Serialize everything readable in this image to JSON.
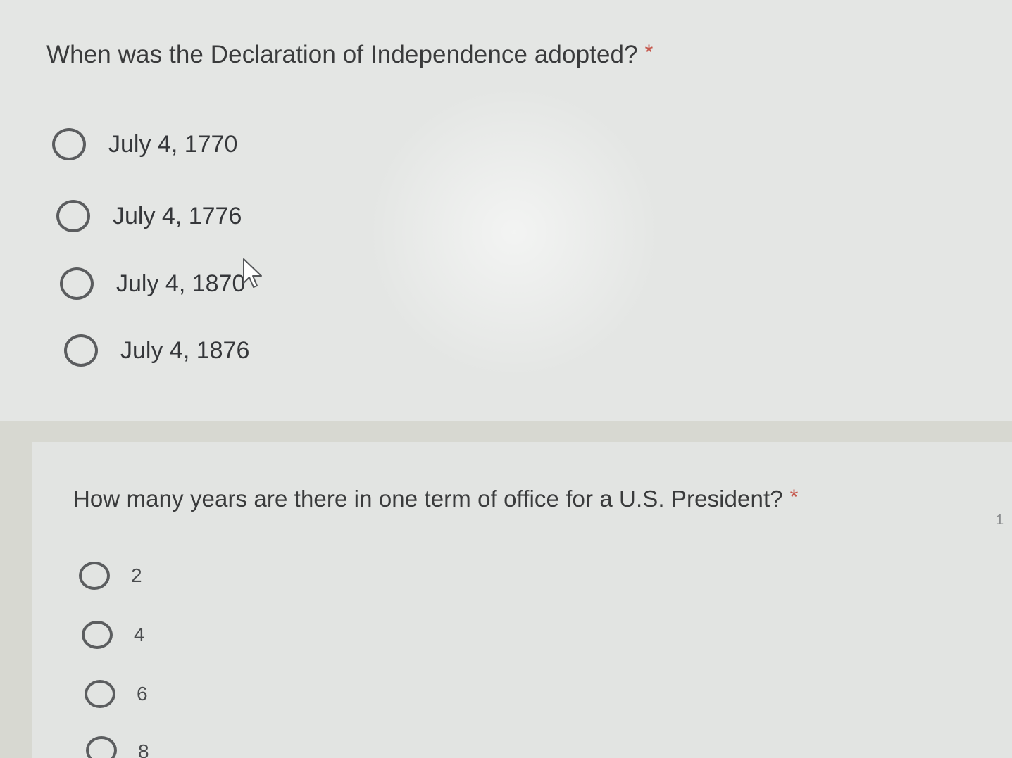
{
  "questions": [
    {
      "title": "When was the Declaration of Independence adopted?",
      "required_marker": "*",
      "options": [
        "July 4, 1770",
        "July 4, 1776",
        "July 4, 1870",
        "July 4, 1876"
      ]
    },
    {
      "title": "How many years are there in one term of office for a U.S. President?",
      "required_marker": "*",
      "options": [
        "2",
        "4",
        "6",
        "8"
      ]
    }
  ],
  "edge_mark": "1",
  "icons": {
    "cursor": "mouse-pointer-icon"
  },
  "colors": {
    "required": "#c5574c",
    "text": "#3a3b3c",
    "radio_border": "#5b5d5f"
  }
}
